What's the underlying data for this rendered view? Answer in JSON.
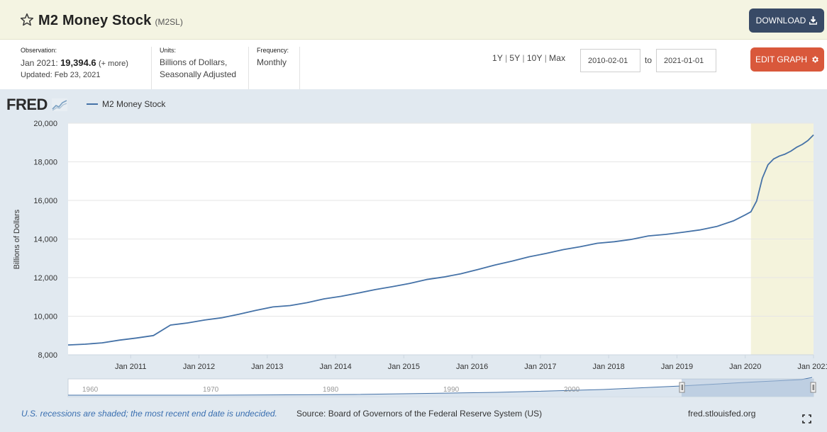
{
  "header": {
    "title": "M2 Money Stock",
    "series_id": "(M2SL)",
    "star_icon": "star-outline-icon",
    "download_label": "DOWNLOAD",
    "download_icon": "download-icon"
  },
  "info": {
    "observation_label": "Observation:",
    "observation_date": "Jan 2021:",
    "observation_value": "19,394.6",
    "observation_more": "(+ more)",
    "updated": "Updated: Feb 23, 2021",
    "units_label": "Units:",
    "units_line1": "Billions of Dollars,",
    "units_line2": "Seasonally Adjusted",
    "frequency_label": "Frequency:",
    "frequency_value": "Monthly"
  },
  "range": {
    "links": [
      "1Y",
      "5Y",
      "10Y",
      "Max"
    ],
    "start_date": "2010-02-01",
    "to_label": "to",
    "end_date": "2021-01-01",
    "edit_label": "EDIT GRAPH",
    "edit_icon": "gear-icon"
  },
  "chart": {
    "logo": "FRED",
    "logo_icon": "fred-chart-icon",
    "fullscreen_icon": "fullscreen-icon"
  },
  "footer": {
    "recession_note": "U.S. recessions are shaded; the most recent end date is undecided.",
    "source": "Source: Board of Governors of the Federal Reserve System (US)",
    "site": "fred.stlouisfed.org"
  },
  "colors": {
    "series": "#4572a7",
    "recession_shade": "#f4f3dc",
    "header_bg": "#f4f4e2",
    "download_btn": "#384a66",
    "edit_btn": "#d9583b",
    "chart_bg": "#e1e9f0"
  },
  "chart_data": {
    "type": "line",
    "title": "",
    "xlabel": "",
    "ylabel": "Billions of Dollars",
    "ylim": [
      8000,
      20000
    ],
    "xlim": [
      "2010-02",
      "2021-01"
    ],
    "grid": true,
    "legend_position": "top-left",
    "y_ticks": [
      "8,000",
      "10,000",
      "12,000",
      "14,000",
      "16,000",
      "18,000",
      "20,000"
    ],
    "x_ticks": [
      "Jan 2011",
      "Jan 2012",
      "Jan 2013",
      "Jan 2014",
      "Jan 2015",
      "Jan 2016",
      "Jan 2017",
      "Jan 2018",
      "Jan 2019",
      "Jan 2020",
      "Jan 2021"
    ],
    "recessions": [
      {
        "start": "2020-02",
        "end": "2021-01"
      }
    ],
    "series": [
      {
        "name": "M2 Money Stock",
        "x": [
          "2010-02",
          "2010-05",
          "2010-08",
          "2010-11",
          "2011-02",
          "2011-05",
          "2011-08",
          "2011-11",
          "2012-02",
          "2012-05",
          "2012-08",
          "2012-11",
          "2013-02",
          "2013-05",
          "2013-08",
          "2013-11",
          "2014-02",
          "2014-05",
          "2014-08",
          "2014-11",
          "2015-02",
          "2015-05",
          "2015-08",
          "2015-11",
          "2016-02",
          "2016-05",
          "2016-08",
          "2016-11",
          "2017-02",
          "2017-05",
          "2017-08",
          "2017-11",
          "2018-02",
          "2018-05",
          "2018-08",
          "2018-11",
          "2019-02",
          "2019-05",
          "2019-08",
          "2019-11",
          "2020-01",
          "2020-02",
          "2020-03",
          "2020-04",
          "2020-05",
          "2020-06",
          "2020-07",
          "2020-08",
          "2020-09",
          "2020-10",
          "2020-11",
          "2020-12",
          "2021-01"
        ],
        "values": [
          8510,
          8550,
          8620,
          8760,
          8870,
          9000,
          9540,
          9650,
          9800,
          9920,
          10100,
          10300,
          10480,
          10550,
          10700,
          10900,
          11030,
          11200,
          11380,
          11530,
          11700,
          11900,
          12030,
          12200,
          12420,
          12650,
          12850,
          13080,
          13250,
          13450,
          13600,
          13780,
          13860,
          13980,
          14160,
          14240,
          14350,
          14470,
          14650,
          14950,
          15250,
          15410,
          15970,
          17150,
          17850,
          18150,
          18300,
          18400,
          18550,
          18750,
          18900,
          19100,
          19394.6
        ]
      }
    ],
    "overview": {
      "labels": [
        "1960",
        "1970",
        "1980",
        "1990",
        "2000"
      ]
    }
  }
}
